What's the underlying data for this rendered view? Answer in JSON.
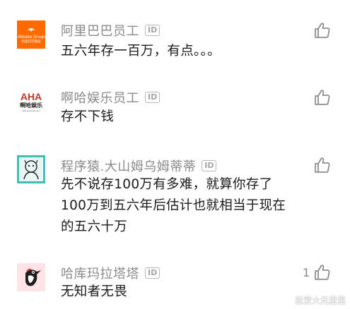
{
  "comments": [
    {
      "username": "阿里巴巴员工",
      "id_badge": "ID",
      "text": "五六年存一百万，有点。。。",
      "likes": "",
      "avatar_icon": "alibaba-logo",
      "avatar_text_main": "Alibaba Group",
      "avatar_text_sub": "阿里巴巴集团",
      "avatar_color": "#ff6a00"
    },
    {
      "username": "啊哈娱乐员工",
      "id_badge": "ID",
      "text": "存不下钱",
      "likes": "",
      "avatar_icon": "aha-logo",
      "avatar_text_main": "AHA",
      "avatar_text_sub": "啊哈娱乐",
      "avatar_text_tiny": "AHA Entertainment"
    },
    {
      "username": "程序猿.大山姆乌姆蒂蒂",
      "id_badge": "ID",
      "text": "先不说存100万有多难，就算你存了100万到五六年后估计也就相当于现在的五六十万",
      "likes": "",
      "avatar_icon": "cartoon-avatar",
      "avatar_color": "#3ec1b4"
    },
    {
      "username": "哈库玛拉塔塔",
      "id_badge": "ID",
      "text": "无知者无畏",
      "likes": "1",
      "avatar_icon": "woodpecker-avatar",
      "avatar_color": "#ffe3e6"
    }
  ],
  "watermark": "恋爱大元里里"
}
